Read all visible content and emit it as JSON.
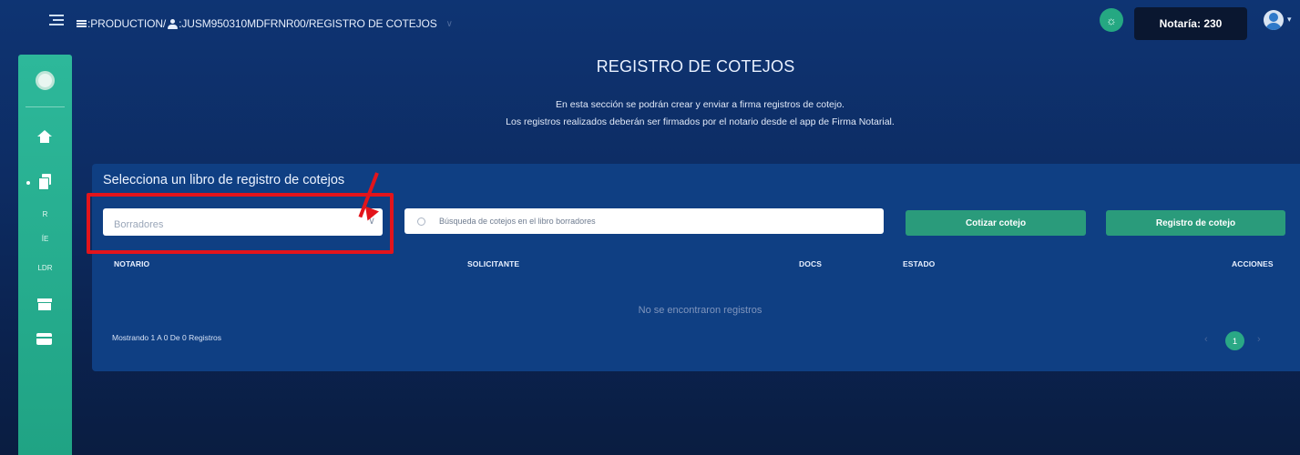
{
  "breadcrumb": {
    "env": ":PRODUCTION/",
    "user": ":JUSM950310MDFRNR00/REGISTRO DE COTEJOS",
    "caret": "∨"
  },
  "header": {
    "notaria": "Notaría: 230",
    "bulb": "☼",
    "avatar_caret": "▾"
  },
  "sidebar": {
    "items": [
      {
        "name": "logo"
      },
      {
        "name": "home-icon"
      },
      {
        "name": "documents-icon"
      },
      {
        "label": "R"
      },
      {
        "label": "ÍE"
      },
      {
        "label": "LDR"
      },
      {
        "name": "archive-icon"
      },
      {
        "name": "card-icon"
      }
    ]
  },
  "page": {
    "title": "REGISTRO DE COTEJOS",
    "intro_line1": "En esta sección se podrán crear y enviar a firma registros de cotejo.",
    "intro_line2": "Los registros realizados deberán ser firmados por el notario desde el app de Firma Notarial."
  },
  "panel": {
    "title": "Selecciona un libro de registro de cotejos",
    "select_value": "Borradores",
    "select_caret": "∨",
    "search_placeholder": "Búsqueda de cotejos en el libro borradores",
    "btn_cotizar": "Cotizar cotejo",
    "btn_registro": "Registro de cotejo",
    "highlight_color": "#e3141b"
  },
  "table": {
    "columns": [
      "NOTARIO",
      "SOLICITANTE",
      "DOCS",
      "ESTADO",
      "ACCIONES"
    ],
    "empty_message": "No se encontraron registros",
    "showing": "Mostrando 1 A 0 De 0 Registros"
  },
  "pagination": {
    "prev": "‹",
    "current": "1",
    "next": "›"
  },
  "colors": {
    "accent": "#2aa885",
    "background": "#0e3473",
    "panel": "#0f3f83"
  }
}
